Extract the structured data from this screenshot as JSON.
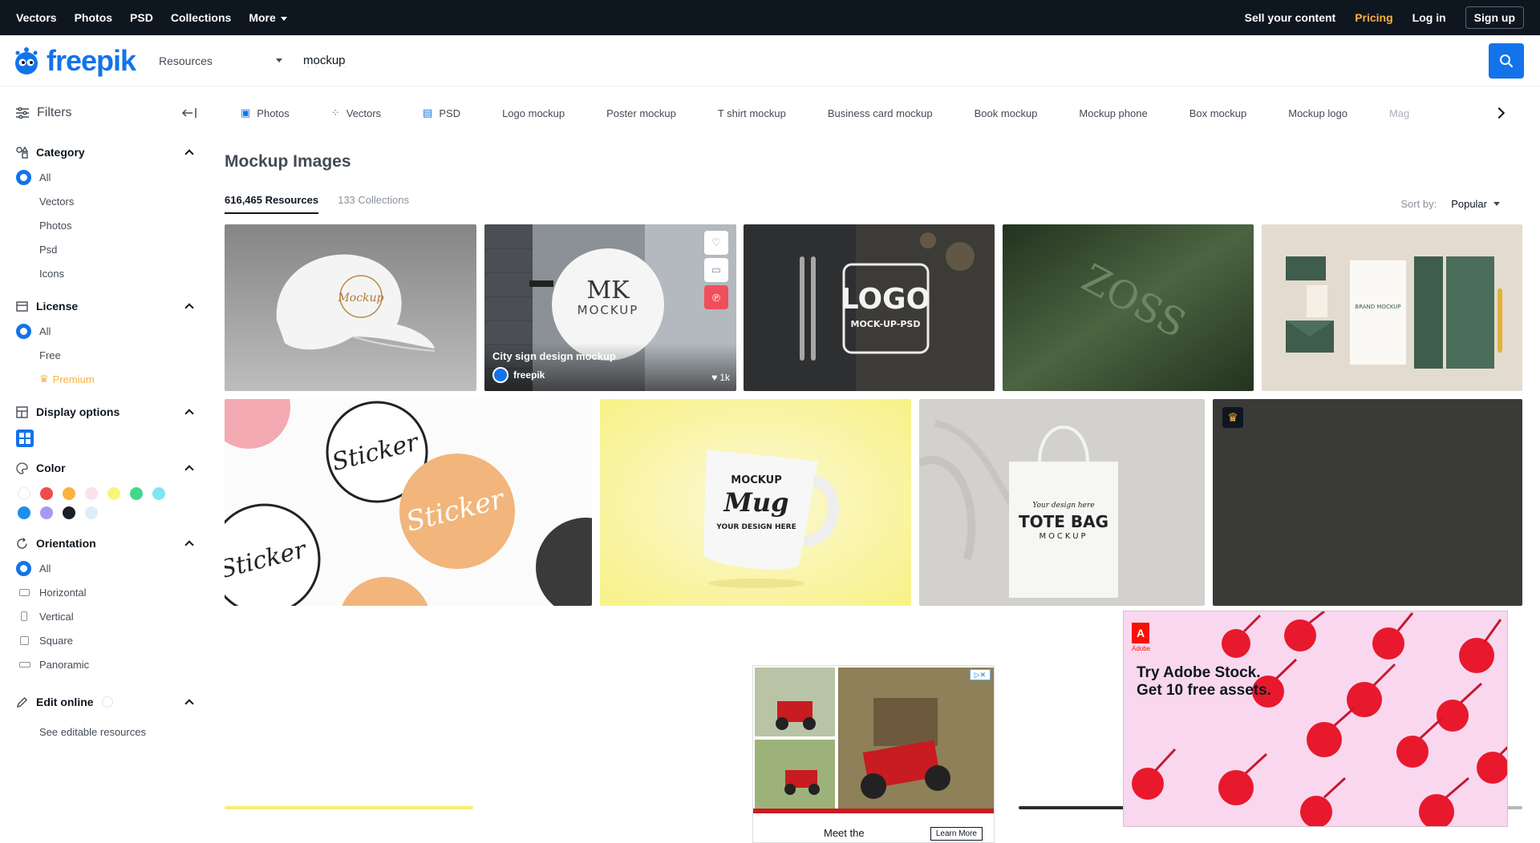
{
  "topbar": {
    "nav": [
      "Vectors",
      "Photos",
      "PSD",
      "Collections",
      "More"
    ],
    "sell": "Sell your content",
    "pricing": "Pricing",
    "login": "Log in",
    "signup": "Sign up"
  },
  "search": {
    "logo": "freepik",
    "resource_type": "Resources",
    "query": "mockup"
  },
  "sidebar": {
    "title": "Filters",
    "category": {
      "title": "Category",
      "options": [
        "All",
        "Vectors",
        "Photos",
        "Psd",
        "Icons"
      ]
    },
    "license": {
      "title": "License",
      "options": [
        "All",
        "Free",
        "Premium"
      ]
    },
    "display": {
      "title": "Display options"
    },
    "color": {
      "title": "Color",
      "swatches": [
        "#ffffff",
        "#f04b4b",
        "#fcb13e",
        "#fbe1ee",
        "#f7f67a",
        "#3fd98c",
        "#7ee7f3",
        "#1c8ef0",
        "#a799f5",
        "#1a1f2b",
        "#ddeefb"
      ]
    },
    "orientation": {
      "title": "Orientation",
      "options": [
        "All",
        "Horizontal",
        "Vertical",
        "Square",
        "Panoramic"
      ]
    },
    "edit": {
      "title": "Edit online",
      "link": "See editable resources"
    }
  },
  "chips": [
    "Photos",
    "Vectors",
    "PSD",
    "Logo mockup",
    "Poster mockup",
    "T shirt mockup",
    "Business card mockup",
    "Book mockup",
    "Mockup phone",
    "Box mockup",
    "Mockup logo",
    "Mag"
  ],
  "page": {
    "title": "Mockup Images",
    "tab_resources": "616,465 Resources",
    "tab_collections": "133 Collections",
    "sort_label": "Sort by:",
    "sort_value": "Popular"
  },
  "cards": {
    "sign": {
      "title": "City sign design mockup",
      "author": "freepik",
      "likes": "1k",
      "sign_line1": "MK",
      "sign_line2": "MOCKUP"
    },
    "cap_text": "Mockup",
    "logo_text": "LOGO",
    "logo_sub": "MOCK-UP-PSD",
    "emboss_text": "ZOSS",
    "brand_text": "BRAND MOCKUP",
    "sticker_text": "Sticker",
    "mug_line1": "MOCKUP",
    "mug_line2": "Mug",
    "mug_line3": "YOUR DESIGN HERE",
    "tote_small": "Your design here",
    "tote_big": "TOTE BAG",
    "tote_sub": "MOCKUP"
  },
  "ads": {
    "adobe_word": "Adobe",
    "popup_line1": "Try Adobe Stock.",
    "popup_line2": "Get 10 free assets.",
    "mid_meet": "Meet the",
    "mid_learn": "Learn More"
  }
}
